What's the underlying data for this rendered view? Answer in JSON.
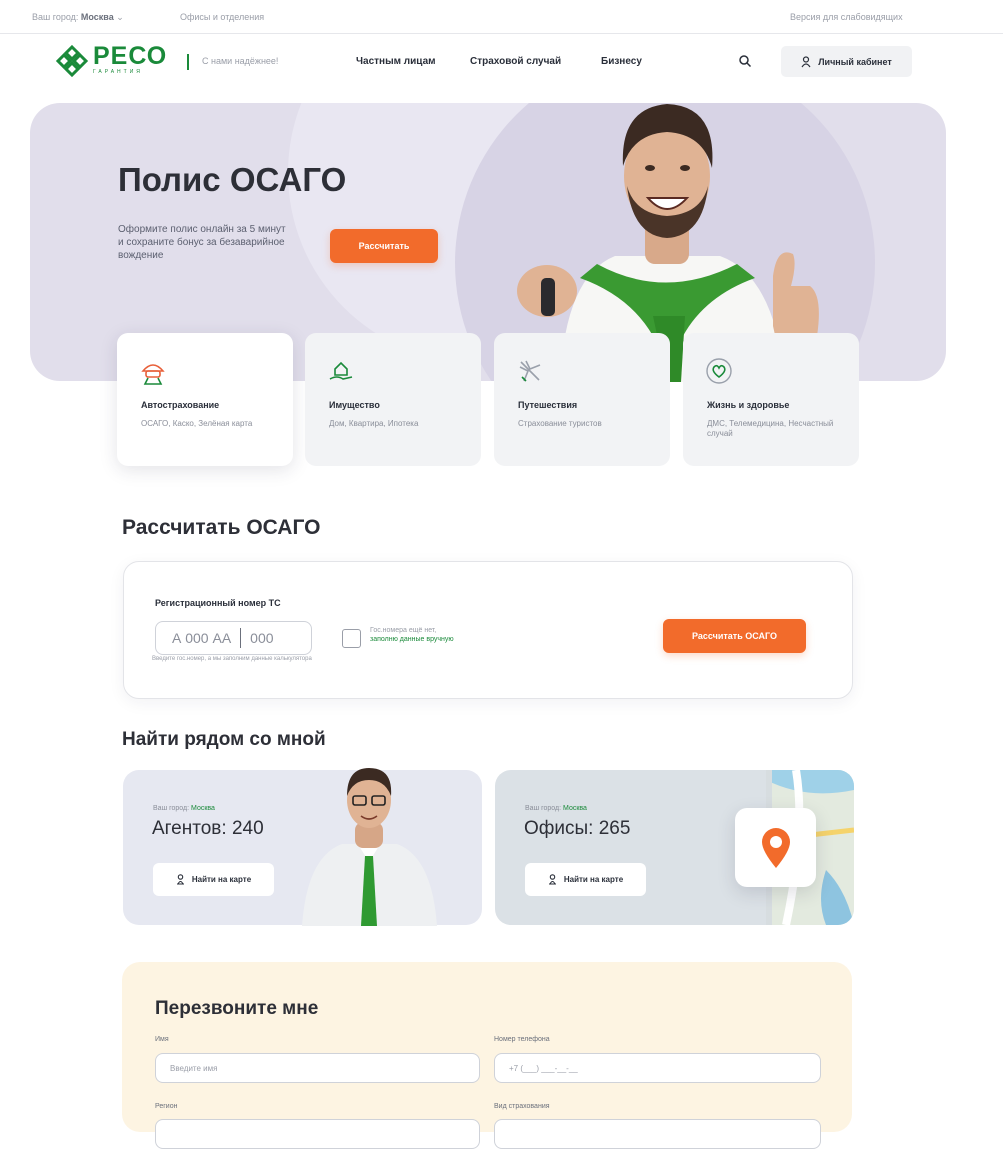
{
  "topbar": {
    "city_label": "Ваш город:",
    "city_value": "Москва",
    "offices_link": "Офисы и отделения",
    "impaired_link": "Версия для слабовидящих"
  },
  "header": {
    "logo_text": "РЕСО",
    "logo_subtext": "ГАРАНТИЯ",
    "slogan": "С нами надёжнее!",
    "nav": [
      "Частным лицам",
      "Страховой случай",
      "Бизнесу"
    ],
    "cabinet_label": "Личный кабинет"
  },
  "hero": {
    "title": "Полис ОСАГО",
    "subtitle": "Оформите полис онлайн за 5 минут и сохраните бонус за безаварийное вождение",
    "button": "Рассчитать"
  },
  "categories": [
    {
      "title": "Автострахование",
      "subtitle": "ОСАГО, Каско, Зелёная карта",
      "icon": "car-umbrella-icon",
      "active": true
    },
    {
      "title": "Имущество",
      "subtitle": "Дом, Квартира, Ипотека",
      "icon": "house-hand-icon",
      "active": false
    },
    {
      "title": "Путешествия",
      "subtitle": "Страхование туристов",
      "icon": "airplane-icon",
      "active": false
    },
    {
      "title": "Жизнь и здоровье",
      "subtitle": "ДМС, Телемедицина, Несчастный случай",
      "icon": "heart-icon",
      "active": false
    }
  ],
  "calculator": {
    "title": "Рассчитать ОСАГО",
    "reg_label": "Регистрационный номер ТС",
    "reg_number_placeholder": "А 000 АА",
    "reg_region_placeholder": "000",
    "no_number_text": "Гос.номера ещё нет,",
    "no_number_link": "заполню данные вручную",
    "hint": "Введите гос.номер, а мы заполним данные калькулятора",
    "button": "Рассчитать ОСАГО"
  },
  "nearby": {
    "title": "Найти рядом со мной",
    "cards": [
      {
        "city_label": "Ваш город:",
        "city": "Москва",
        "count_text": "Агентов: 240",
        "button": "Найти на карте"
      },
      {
        "city_label": "Ваш город:",
        "city": "Москва",
        "count_text": "Офисы: 265",
        "button": "Найти на карте"
      }
    ]
  },
  "callback": {
    "title": "Перезвоните мне",
    "name_label": "Имя",
    "name_placeholder": "Введите имя",
    "phone_label": "Номер телефона",
    "phone_placeholder": "+7 (___) ___-__-__",
    "region_label": "Регион",
    "insurance_type_label": "Вид страхования"
  },
  "colors": {
    "brand_green": "#1a8a3a",
    "accent_orange": "#f26b2b",
    "hero_bg": "#e1deeb",
    "callback_bg": "#fdf4e2"
  }
}
